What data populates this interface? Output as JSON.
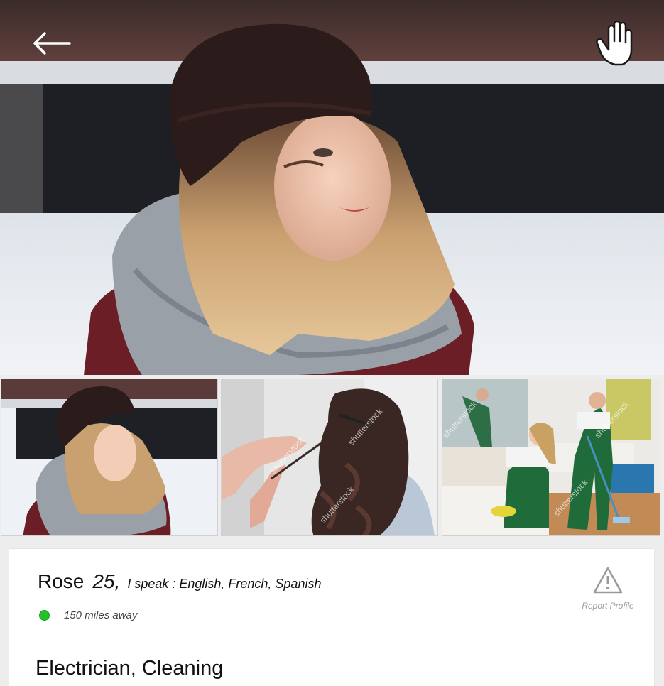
{
  "header": {
    "back_icon": "arrow-left-icon",
    "hand_icon": "raised-hand-icon"
  },
  "hero": {
    "image": "portrait-woman-beanie-scarf-snow"
  },
  "gallery": {
    "thumbnails": [
      {
        "image": "portrait-woman-beanie-scarf-snow",
        "watermark": ""
      },
      {
        "image": "hair-styling-curls",
        "watermark": "shutterstock"
      },
      {
        "image": "cleaning-service-workers",
        "watermark": "shutterstock"
      }
    ]
  },
  "profile": {
    "name": "Rose",
    "age": "25,",
    "languages": "I speak : English, French, Spanish",
    "distance": "150 miles away",
    "online_status_color": "#22c22b",
    "report_label": "Report Profile",
    "report_icon": "warning-triangle-icon",
    "services": "Electrician, Cleaning"
  }
}
